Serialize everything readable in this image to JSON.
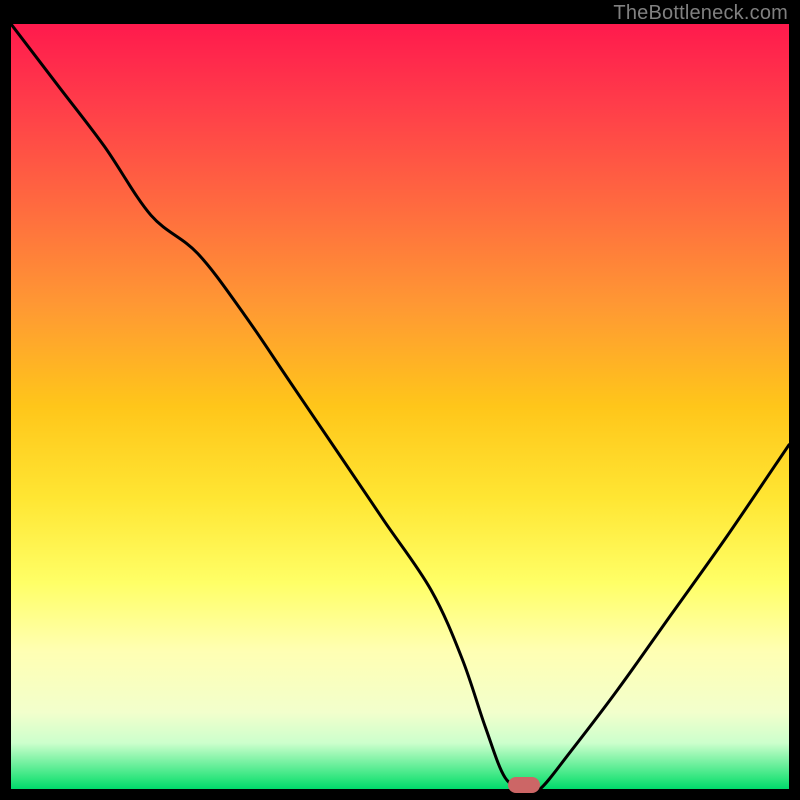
{
  "watermark": "TheBottleneck.com",
  "chart_data": {
    "type": "line",
    "title": "",
    "xlabel": "",
    "ylabel": "",
    "xlim": [
      0,
      100
    ],
    "ylim": [
      0,
      100
    ],
    "series": [
      {
        "name": "bottleneck-curve",
        "x": [
          0,
          6,
          12,
          18,
          24,
          30,
          36,
          42,
          48,
          54,
          58,
          61,
          63.5,
          66,
          68,
          72,
          78,
          85,
          92,
          100
        ],
        "y": [
          100,
          92,
          84,
          75,
          70,
          62,
          53,
          44,
          35,
          26,
          17,
          8,
          1.5,
          0,
          0,
          5,
          13,
          23,
          33,
          45
        ]
      }
    ],
    "marker": {
      "x": 66,
      "y": 0.5,
      "color": "#cc6666"
    },
    "gradient_stops": [
      {
        "pos": 0,
        "color": "#ff1a4d"
      },
      {
        "pos": 0.1,
        "color": "#ff3b4a"
      },
      {
        "pos": 0.24,
        "color": "#ff6b3f"
      },
      {
        "pos": 0.37,
        "color": "#ff9933"
      },
      {
        "pos": 0.5,
        "color": "#ffc61a"
      },
      {
        "pos": 0.62,
        "color": "#ffe633"
      },
      {
        "pos": 0.73,
        "color": "#ffff66"
      },
      {
        "pos": 0.82,
        "color": "#ffffb3"
      },
      {
        "pos": 0.9,
        "color": "#f2ffcc"
      },
      {
        "pos": 0.94,
        "color": "#ccffcc"
      },
      {
        "pos": 0.985,
        "color": "#33e680"
      },
      {
        "pos": 1.0,
        "color": "#00d96b"
      }
    ]
  }
}
